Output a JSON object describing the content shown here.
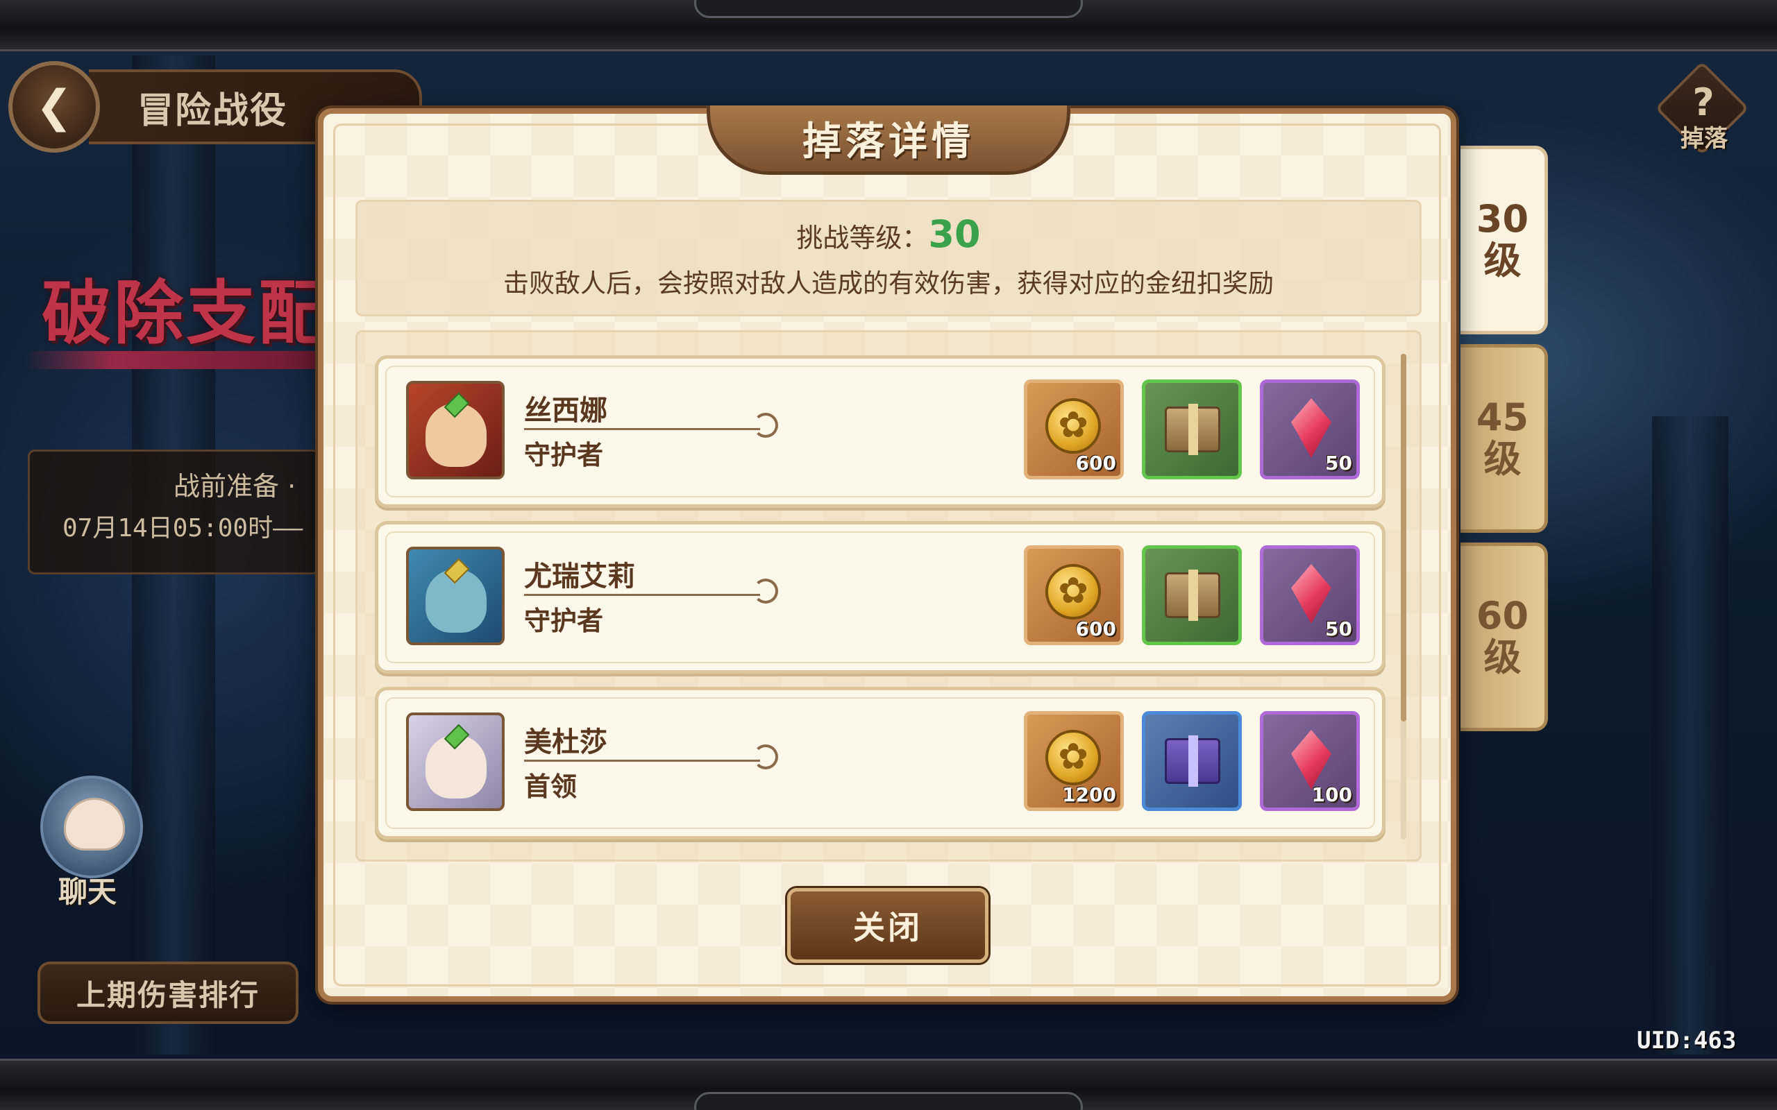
{
  "colors": {
    "panel_bg": "#fbf3e1",
    "panel_border": "#a8784b",
    "level_value": "#3aa24a",
    "text_brown": "#5b3b22"
  },
  "hud": {
    "back_icon": "back-arrow-icon",
    "title": "冒险战役",
    "event_banner": "破除支配",
    "prep_label": "战前准备 ·",
    "prep_time": "07月14日05:00时——",
    "chat_label": "聊天",
    "rank_button": "上期伤害排行",
    "drop_help_symbol": "?",
    "drop_help_label": "掉落",
    "uid": "UID:463"
  },
  "level_tabs": [
    {
      "num": "30",
      "unit": "级",
      "active": true
    },
    {
      "num": "45",
      "unit": "级",
      "active": false
    },
    {
      "num": "60",
      "unit": "级",
      "active": false
    }
  ],
  "modal": {
    "title": "掉落详情",
    "challenge_label": "挑战等级：",
    "challenge_level": "30",
    "description": "击败敌人后，会按照对敌人造成的有效伤害，获得对应的金纽扣奖励",
    "close_button": "关闭"
  },
  "enemies": [
    {
      "name": "丝西娜",
      "role": "守护者",
      "portrait_icon": "red-haired-guardian-portrait",
      "rewards": [
        {
          "icon": "gold-button-coin-icon",
          "count": "600"
        },
        {
          "icon": "brown-gift-box-icon",
          "count": ""
        },
        {
          "icon": "pink-crystal-icon",
          "count": "50"
        }
      ]
    },
    {
      "name": "尤瑞艾莉",
      "role": "守护者",
      "portrait_icon": "blue-haired-guardian-portrait",
      "rewards": [
        {
          "icon": "gold-button-coin-icon",
          "count": "600"
        },
        {
          "icon": "brown-gift-box-icon",
          "count": ""
        },
        {
          "icon": "pink-crystal-icon",
          "count": "50"
        }
      ]
    },
    {
      "name": "美杜莎",
      "role": "首领",
      "portrait_icon": "white-haired-boss-portrait",
      "rewards": [
        {
          "icon": "gold-button-coin-icon",
          "count": "1200"
        },
        {
          "icon": "purple-gift-box-icon",
          "count": ""
        },
        {
          "icon": "pink-crystal-icon",
          "count": "100"
        }
      ]
    }
  ]
}
